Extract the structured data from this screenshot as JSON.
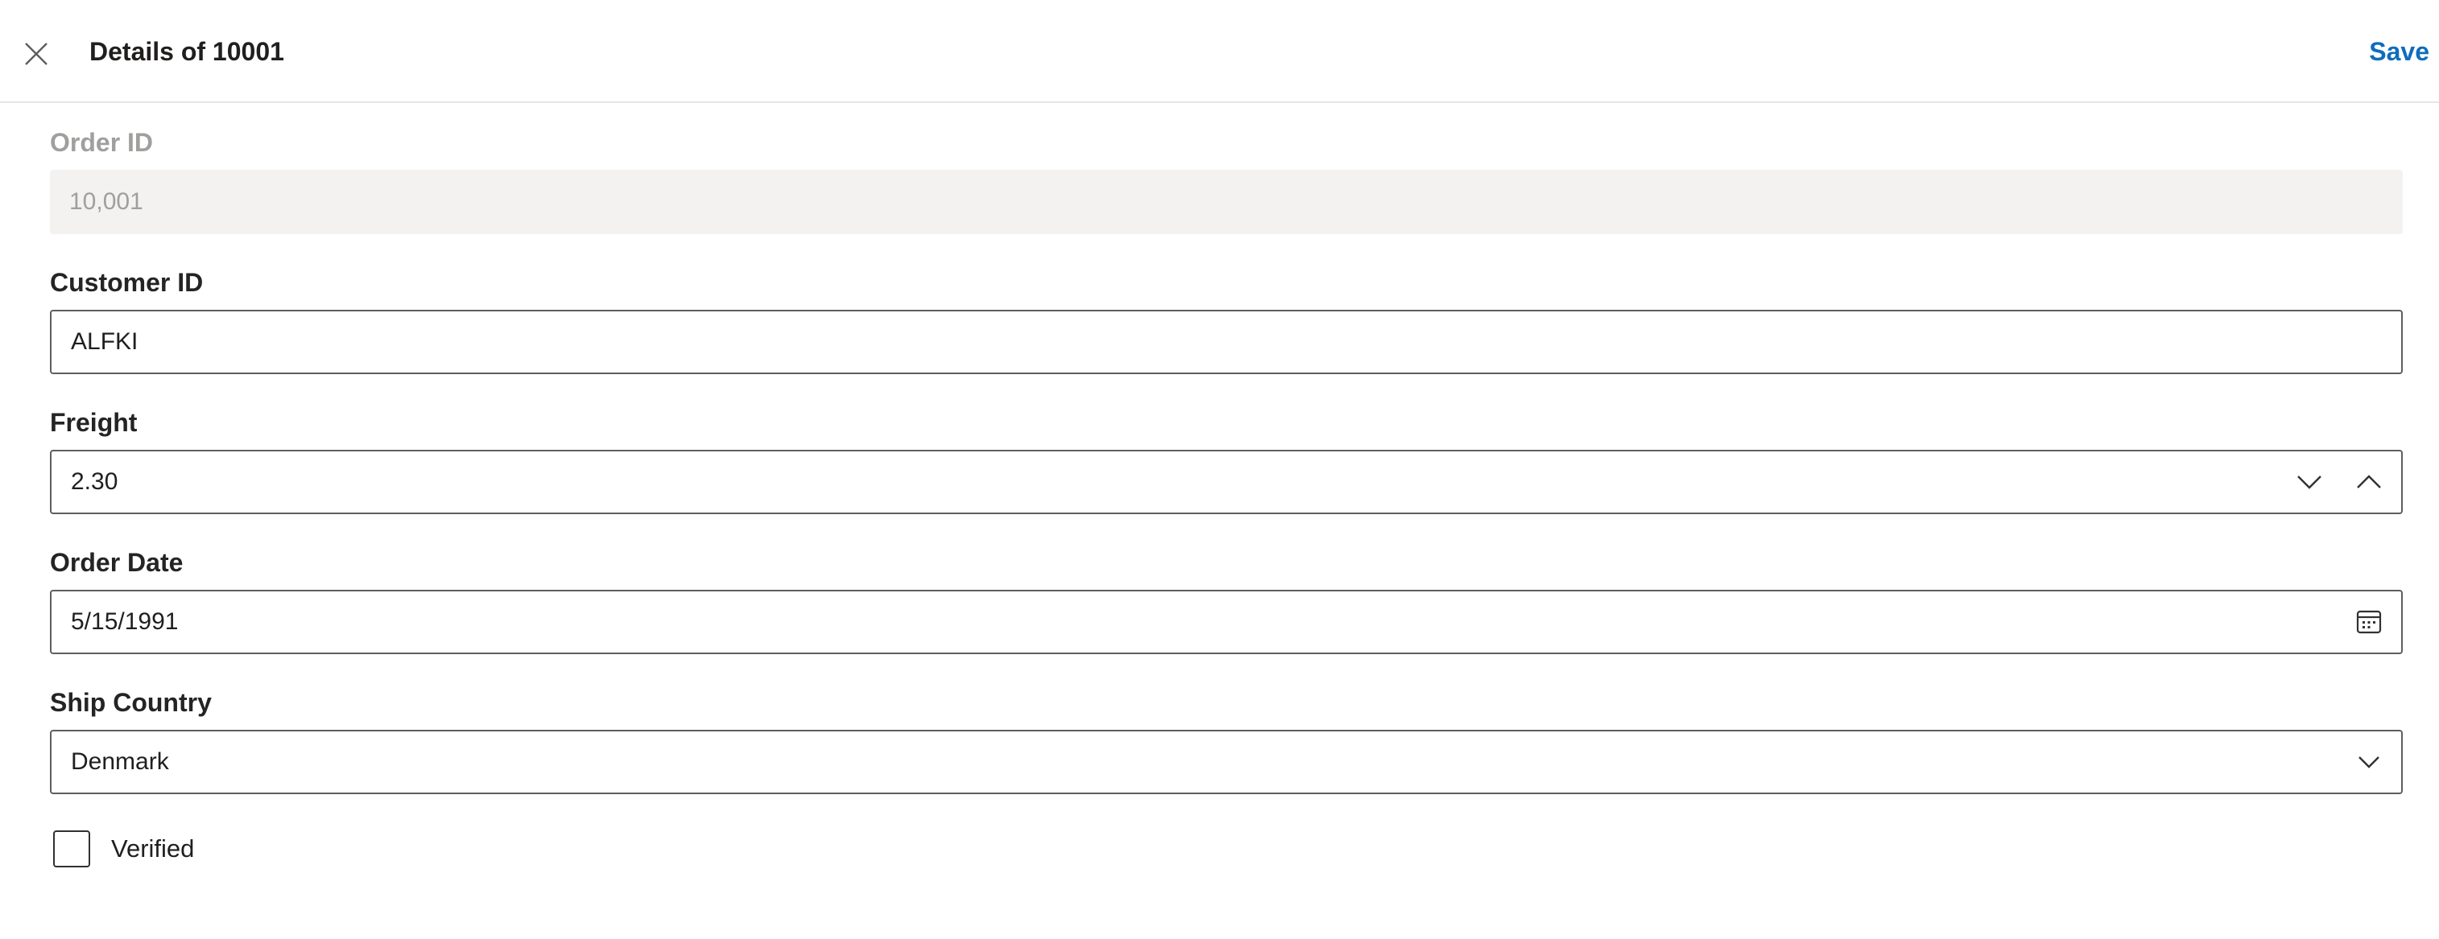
{
  "header": {
    "title": "Details of 10001",
    "save_label": "Save",
    "close_icon": "close-icon"
  },
  "form": {
    "order_id": {
      "label": "Order ID",
      "value": "10,001",
      "disabled": true
    },
    "customer_id": {
      "label": "Customer ID",
      "value": "ALFKI"
    },
    "freight": {
      "label": "Freight",
      "value": "2.30",
      "icons": [
        "chevron-down-icon",
        "chevron-up-icon"
      ]
    },
    "order_date": {
      "label": "Order Date",
      "value": "5/15/1991",
      "icon": "calendar-icon"
    },
    "ship_country": {
      "label": "Ship Country",
      "value": "Denmark",
      "icon": "chevron-down-icon"
    },
    "verified": {
      "label": "Verified",
      "checked": false
    }
  },
  "colors": {
    "accent": "#0f6cbd",
    "border": "#605e5c",
    "disabled_bg": "#f3f2f1",
    "disabled_text": "#a19f9d"
  }
}
